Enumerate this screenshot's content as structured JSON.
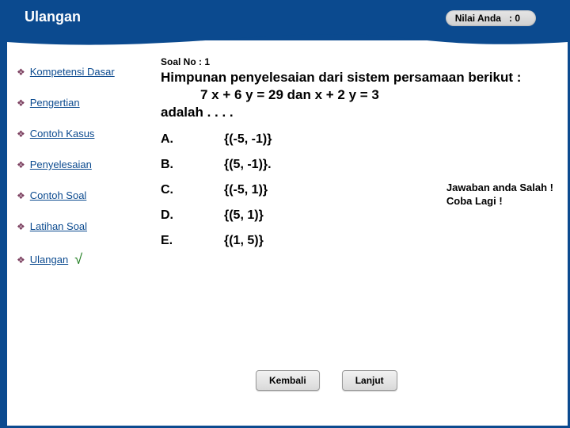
{
  "header": {
    "title": "Ulangan",
    "score_label": "Nilai Anda",
    "score_value": ": 0"
  },
  "sidebar": {
    "items": [
      {
        "label": "Kompetensi Dasar",
        "checked": false
      },
      {
        "label": "Pengertian",
        "checked": false
      },
      {
        "label": "Contoh Kasus",
        "checked": false
      },
      {
        "label": "Penyelesaian",
        "checked": false
      },
      {
        "label": "Contoh Soal",
        "checked": false
      },
      {
        "label": "Latihan Soal",
        "checked": false
      },
      {
        "label": "Ulangan",
        "checked": true
      }
    ]
  },
  "quiz": {
    "number_label": "Soal No : 1",
    "question_line1": "Himpunan penyelesaian dari sistem persamaan berikut :",
    "question_line2": "7 x + 6 y = 29 dan x + 2 y = 3",
    "question_line3": "adalah . . . .",
    "options": [
      {
        "letter": "A.",
        "text": "{(-5, -1)}"
      },
      {
        "letter": "B.",
        "text": "{(5, -1)}."
      },
      {
        "letter": "C.",
        "text": "{(-5, 1)}"
      },
      {
        "letter": "D.",
        "text": "{(5, 1)}"
      },
      {
        "letter": "E.",
        "text": "{(1, 5)}"
      }
    ],
    "feedback_line1": "Jawaban anda Salah !",
    "feedback_line2": "Coba Lagi !"
  },
  "buttons": {
    "back": "Kembali",
    "next": "Lanjut"
  }
}
